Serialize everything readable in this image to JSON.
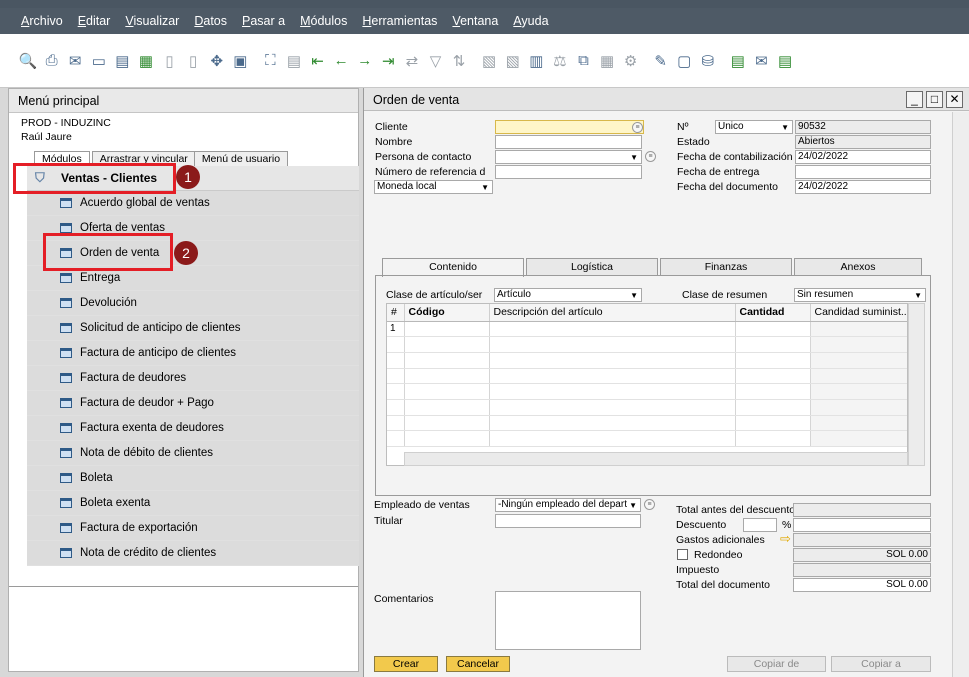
{
  "menu": [
    "Archivo",
    "Editar",
    "Visualizar",
    "Datos",
    "Pasar a",
    "Módulos",
    "Herramientas",
    "Ventana",
    "Ayuda"
  ],
  "toolbar_icons": [
    "preview-icon",
    "print-icon",
    "email-icon",
    "sms-icon",
    "fax-icon",
    "excel-icon",
    "word-icon",
    "pdf-icon",
    "launch-app-icon",
    "lock-screen-icon",
    "find-icon",
    "add-icon",
    "first-record-icon",
    "previous-record-icon",
    "next-record-icon",
    "last-record-icon",
    "refresh-icon",
    "filter-icon",
    "sort-icon",
    "base-document-icon",
    "target-document-icon",
    "gross-profit-icon",
    "volume-weight-icon",
    "relationship-map-icon",
    "settings-icon",
    "document-settings-icon",
    "form-settings-icon",
    "authorizations-icon",
    "macro-icon",
    "calendar-icon",
    "messages-icon",
    "more-icon"
  ],
  "left_panel": {
    "title": "Menú principal",
    "company": "PROD - INDUZINC",
    "user": "Raúl Jaure",
    "tabs": [
      "Módulos",
      "Arrastrar y vincular",
      "Menú de usuario"
    ],
    "group": "Ventas - Clientes",
    "items": [
      "Acuerdo global de ventas",
      "Oferta de ventas",
      "Orden de venta",
      "Entrega",
      "Devolución",
      "Solicitud de anticipo de clientes",
      "Factura de anticipo de clientes",
      "Factura de deudores",
      "Factura de deudor + Pago",
      "Factura exenta de deudores",
      "Nota de débito de clientes",
      "Boleta",
      "Boleta exenta",
      "Factura de exportación",
      "Nota de crédito de clientes"
    ],
    "badges": [
      "1",
      "2"
    ]
  },
  "form": {
    "title": "Orden de venta",
    "labels": {
      "cliente": "Cliente",
      "nombre": "Nombre",
      "persona": "Persona de contacto",
      "numref": "Número de referencia d",
      "no": "Nº",
      "estado": "Estado",
      "fecha_contab": "Fecha de contabilización",
      "fecha_entrega": "Fecha de entrega",
      "fecha_doc": "Fecha del documento"
    },
    "values": {
      "moneda": "Moneda local",
      "serie": "Unico",
      "numero": "90532",
      "estado": "Abiertos",
      "fecha_contab": "24/02/2022",
      "fecha_doc": "24/02/2022"
    },
    "tabs": [
      "Contenido",
      "Logística",
      "Finanzas",
      "Anexos"
    ],
    "clase_articulo_label": "Clase de artículo/ser",
    "clase_articulo_value": "Artículo",
    "clase_resumen_label": "Clase de resumen",
    "clase_resumen_value": "Sin resumen",
    "grid_headers": [
      "#",
      "Código",
      "Descripción del artículo",
      "Cantidad",
      "Candidad suminist..."
    ],
    "grid_first_row": "1",
    "footer": {
      "empleado_label": "Empleado de ventas",
      "empleado_value": "-Ningún empleado del depart",
      "titular_label": "Titular",
      "comentarios_label": "Comentarios",
      "total_antes": "Total antes del descuento",
      "descuento": "Descuento",
      "pct": "%",
      "gastos": "Gastos adicionales",
      "redondeo": "Redondeo",
      "redondeo_value": "SOL 0.00",
      "impuesto": "Impuesto",
      "total_doc": "Total del documento",
      "total_doc_value": "SOL 0.00"
    },
    "buttons": {
      "crear": "Crear",
      "cancelar": "Cancelar",
      "copiar_de": "Copiar de",
      "copiar_a": "Copiar a"
    }
  }
}
